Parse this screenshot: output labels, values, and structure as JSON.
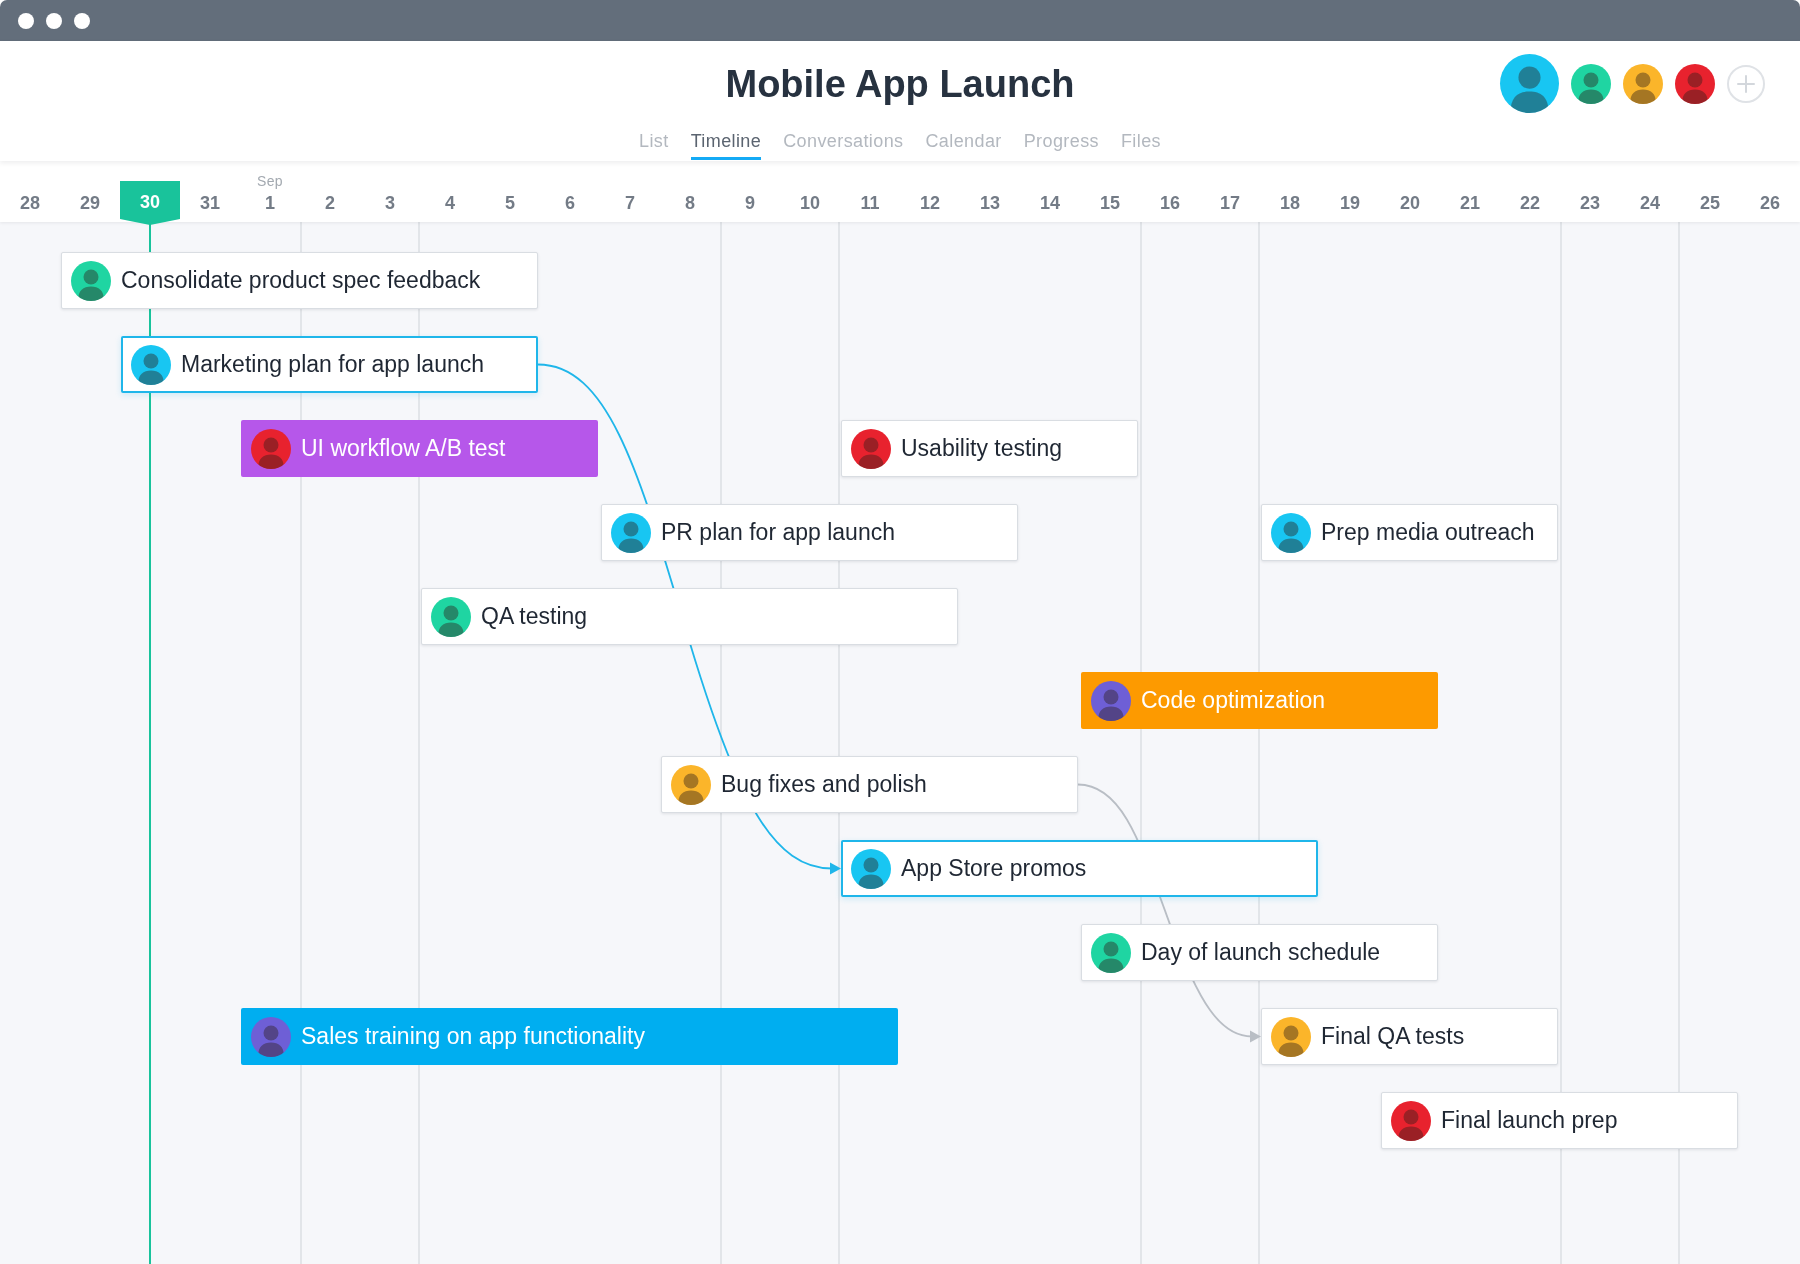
{
  "project": {
    "title": "Mobile App Launch",
    "tabs": [
      {
        "label": "List",
        "selected": false
      },
      {
        "label": "Timeline",
        "selected": true
      },
      {
        "label": "Conversations",
        "selected": false
      },
      {
        "label": "Calendar",
        "selected": false
      },
      {
        "label": "Progress",
        "selected": false
      },
      {
        "label": "Files",
        "selected": false
      }
    ],
    "members": [
      {
        "kind": "owner",
        "color": "#18c6f2"
      },
      {
        "kind": "member",
        "color": "#1fd5a2"
      },
      {
        "kind": "member",
        "color": "#fbb52a"
      },
      {
        "kind": "member",
        "color": "#e8222e"
      }
    ]
  },
  "timeline": {
    "dates": [
      {
        "day": "28",
        "weekend": false,
        "today": false
      },
      {
        "day": "29",
        "weekend": false,
        "today": false
      },
      {
        "day": "30",
        "weekend": false,
        "today": true
      },
      {
        "day": "31",
        "weekend": false,
        "today": false
      },
      {
        "day": "1",
        "month": "Sep",
        "weekend": false,
        "today": false
      },
      {
        "day": "2",
        "weekend": true,
        "today": false
      },
      {
        "day": "3",
        "weekend": true,
        "today": false
      },
      {
        "day": "4",
        "weekend": false,
        "today": false
      },
      {
        "day": "5",
        "weekend": false,
        "today": false
      },
      {
        "day": "6",
        "weekend": false,
        "today": false
      },
      {
        "day": "7",
        "weekend": false,
        "today": false
      },
      {
        "day": "8",
        "weekend": false,
        "today": false
      },
      {
        "day": "9",
        "weekend": true,
        "today": false
      },
      {
        "day": "10",
        "weekend": true,
        "today": false
      },
      {
        "day": "11",
        "weekend": false,
        "today": false
      },
      {
        "day": "12",
        "weekend": false,
        "today": false
      },
      {
        "day": "13",
        "weekend": false,
        "today": false
      },
      {
        "day": "14",
        "weekend": false,
        "today": false
      },
      {
        "day": "15",
        "weekend": false,
        "today": false
      },
      {
        "day": "16",
        "weekend": true,
        "today": false
      },
      {
        "day": "17",
        "weekend": true,
        "today": false
      },
      {
        "day": "18",
        "weekend": false,
        "today": false
      },
      {
        "day": "19",
        "weekend": false,
        "today": false
      },
      {
        "day": "20",
        "weekend": false,
        "today": false
      },
      {
        "day": "21",
        "weekend": false,
        "today": false
      },
      {
        "day": "22",
        "weekend": false,
        "today": false
      },
      {
        "day": "23",
        "weekend": true,
        "today": false
      },
      {
        "day": "24",
        "weekend": true,
        "today": false
      },
      {
        "day": "25",
        "weekend": false,
        "today": false
      },
      {
        "day": "26",
        "weekend": false,
        "today": false
      }
    ],
    "rows": [
      {
        "tasks": [
          {
            "title": "Consolidate product spec feedback",
            "highlighted": false,
            "assignee": {
              "color": "#1fd5a2"
            }
          }
        ]
      },
      {
        "tasks": [
          {
            "title": "Marketing plan for app launch",
            "highlighted": true,
            "assignee": {
              "color": "#18c6f2"
            }
          }
        ]
      },
      {
        "tasks": [
          {
            "title": "UI workflow A/B test",
            "highlighted": false,
            "color": "#b657ea",
            "assignee": {
              "color": "#e8222e"
            }
          },
          {
            "title": "Usability testing",
            "highlighted": false,
            "assignee": {
              "color": "#e8222e"
            }
          }
        ]
      },
      {
        "tasks": [
          {
            "title": "PR plan for app launch",
            "highlighted": false,
            "assignee": {
              "color": "#18c6f2"
            }
          },
          {
            "title": "Prep media outreach",
            "highlighted": false,
            "assignee": {
              "color": "#18c6f2"
            }
          }
        ]
      },
      {
        "tasks": [
          {
            "title": "QA testing",
            "highlighted": false,
            "assignee": {
              "color": "#1fd5a2"
            }
          }
        ]
      },
      {
        "tasks": [
          {
            "title": "Code optimization",
            "highlighted": false,
            "color": "#fd9a00",
            "assignee": {
              "color": "#6e5fd6"
            }
          }
        ]
      },
      {
        "tasks": [
          {
            "title": "Bug fixes and polish",
            "highlighted": false,
            "assignee": {
              "color": "#fbb52a"
            }
          }
        ]
      },
      {
        "tasks": [
          {
            "title": "App Store promos",
            "highlighted": true,
            "assignee": {
              "color": "#18c6f2"
            }
          }
        ]
      },
      {
        "tasks": [
          {
            "title": "Day of launch schedule",
            "highlighted": false,
            "assignee": {
              "color": "#1fd5a2"
            }
          }
        ]
      },
      {
        "tasks": [
          {
            "title": "Sales training on app functionality",
            "highlighted": false,
            "color": "#00aef0",
            "assignee": {
              "color": "#6e5fd6"
            }
          },
          {
            "title": "Final QA tests",
            "highlighted": false,
            "assignee": {
              "color": "#fbb52a"
            }
          }
        ]
      },
      {
        "tasks": [
          {
            "title": "Final launch prep",
            "highlighted": false,
            "assignee": {
              "color": "#e8222e"
            }
          }
        ]
      }
    ],
    "dependencies": [
      {
        "highlighted": true
      },
      {
        "highlighted": false
      }
    ]
  }
}
